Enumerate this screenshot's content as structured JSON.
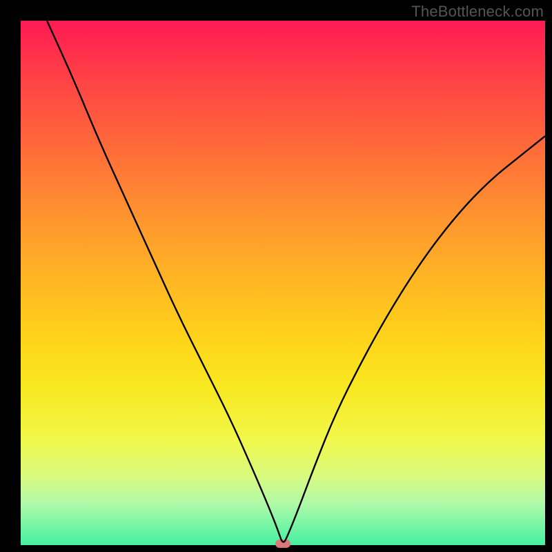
{
  "watermark": "TheBottleneck.com",
  "chart_data": {
    "type": "line",
    "title": "",
    "xlabel": "",
    "ylabel": "",
    "xlim": [
      0,
      100
    ],
    "ylim": [
      0,
      100
    ],
    "x": [
      5,
      10,
      15,
      20,
      25,
      30,
      35,
      40,
      44,
      47,
      49,
      50,
      51,
      53,
      56,
      60,
      65,
      70,
      75,
      80,
      85,
      90,
      95,
      100
    ],
    "values": [
      100,
      89,
      77,
      66,
      55,
      44,
      34,
      24,
      15,
      8,
      3,
      0,
      2,
      7,
      15,
      25,
      35,
      44,
      52,
      59,
      65,
      70,
      74,
      78
    ],
    "minimum": {
      "x": 50,
      "y": 0
    },
    "background_gradient": {
      "top": "#ff1a54",
      "mid": "#ffd21a",
      "bottom": "#45f1a0"
    },
    "marker_color": "#d97a78"
  }
}
